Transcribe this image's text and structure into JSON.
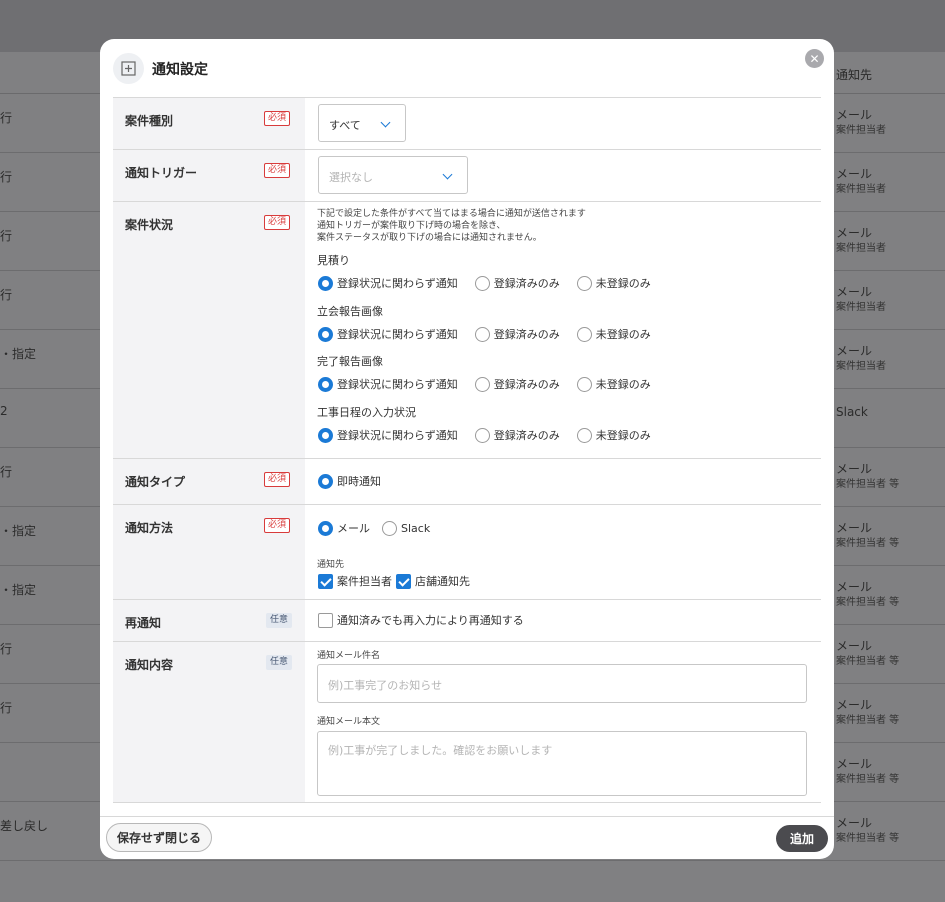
{
  "background": {
    "column_header_notify_to": "通知先",
    "rows": [
      {
        "left": "行",
        "right": "メール",
        "sub": "案件担当者"
      },
      {
        "left": "行",
        "right": "メール",
        "sub": "案件担当者"
      },
      {
        "left": "行",
        "right": "メール",
        "sub": "案件担当者"
      },
      {
        "left": "行",
        "right": "メール",
        "sub": "案件担当者"
      },
      {
        "left": "・指定",
        "right": "メール",
        "sub": "案件担当者"
      },
      {
        "left": "2",
        "right": "Slack",
        "sub": ""
      },
      {
        "left": "行",
        "right": "メール",
        "sub": "案件担当者 等"
      },
      {
        "left": "・指定",
        "right": "メール",
        "sub": "案件担当者 等"
      },
      {
        "left": "・指定",
        "right": "メール",
        "sub": "案件担当者 等"
      },
      {
        "left": "行",
        "right": "メール",
        "sub": "案件担当者 等"
      },
      {
        "left": "行",
        "right": "メール",
        "sub": "案件担当者 等"
      },
      {
        "left": "",
        "right": "メール",
        "sub": "案件担当者 等"
      },
      {
        "left": "差し戻し",
        "right": "メール",
        "sub": "案件担当者 等"
      }
    ]
  },
  "modal": {
    "title": "通知設定",
    "close_icon": "close-icon",
    "header_icon": "plus-square-icon",
    "badges": {
      "required": "必須",
      "optional": "任意"
    },
    "project_type": {
      "label": "案件種別",
      "value": "すべて"
    },
    "trigger": {
      "label": "通知トリガー",
      "placeholder": "選択なし"
    },
    "status": {
      "label": "案件状況",
      "note_lines": [
        "下記で設定した条件がすべて当てはまる場合に通知が送信されます",
        "通知トリガーが案件取り下げ時の場合を除き、",
        "案件ステータスが取り下げの場合には通知されません。"
      ],
      "options": [
        "登録状況に関わらず通知",
        "登録済みのみ",
        "未登録のみ"
      ],
      "groups": [
        {
          "title": "見積り",
          "selected": 0
        },
        {
          "title": "立会報告画像",
          "selected": 0
        },
        {
          "title": "完了報告画像",
          "selected": 0
        },
        {
          "title": "工事日程の入力状況",
          "selected": 0
        }
      ]
    },
    "notify_type": {
      "label": "通知タイプ",
      "option": "即時通知"
    },
    "notify_method": {
      "label": "通知方法",
      "options": [
        "メール",
        "Slack"
      ],
      "selected": 0,
      "recipients_label": "通知先",
      "recipients": [
        {
          "label": "案件担当者",
          "checked": true
        },
        {
          "label": "店舗通知先",
          "checked": true
        }
      ]
    },
    "renotify": {
      "label": "再通知",
      "option": "通知済みでも再入力により再通知する",
      "checked": false
    },
    "content": {
      "label": "通知内容",
      "subject_label": "通知メール件名",
      "subject_placeholder": "例)工事完了のお知らせ",
      "body_label": "通知メール本文",
      "body_placeholder": "例)工事が完了しました。確認をお願いします"
    },
    "footer": {
      "close_label": "保存せず閉じる",
      "add_label": "追加"
    },
    "colors": {
      "accent": "#1b7ad6",
      "required": "#d83b3b",
      "add_button": "#4b4b4f"
    }
  }
}
